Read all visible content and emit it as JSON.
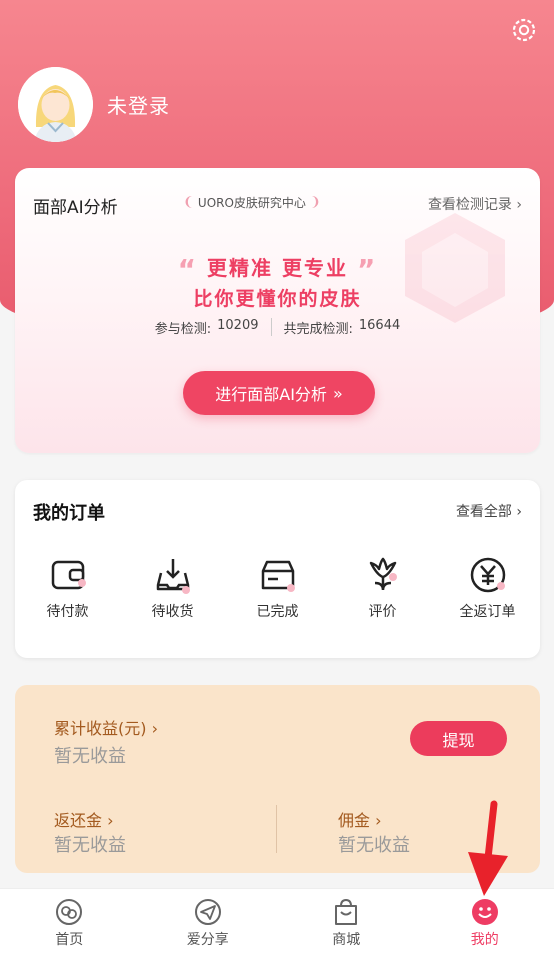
{
  "colors": {
    "accent": "#ef4563",
    "hero": "#ee6b7b",
    "earn_bg": "#fae4ca",
    "earn_text": "#a35a1f"
  },
  "header": {
    "user_name": "未登录",
    "settings_icon": "gear-icon"
  },
  "ai_card": {
    "title": "面部AI分析",
    "center_label": "UORO皮肤研究中心",
    "history_link": "查看检测记录",
    "slogan_line1": "更精准 更专业",
    "slogan_line2": "比你更懂你的皮肤",
    "participated_label": "参与检测:",
    "participated_value": "10209",
    "completed_label": "共完成检测:",
    "completed_value": "16644",
    "cta": "进行面部AI分析"
  },
  "orders": {
    "title": "我的订单",
    "view_all": "查看全部",
    "items": [
      {
        "label": "待付款",
        "icon": "wallet-icon"
      },
      {
        "label": "待收货",
        "icon": "inbox-download-icon"
      },
      {
        "label": "已完成",
        "icon": "box-icon"
      },
      {
        "label": "评价",
        "icon": "tulip-icon"
      },
      {
        "label": "全返订单",
        "icon": "yen-icon"
      }
    ]
  },
  "earnings": {
    "total_label": "累计收益(元)",
    "total_value": "暂无收益",
    "withdraw": "提现",
    "rebate_label": "返还金",
    "rebate_value": "暂无收益",
    "commission_label": "佣金",
    "commission_value": "暂无收益"
  },
  "tabbar": [
    {
      "label": "首页",
      "icon": "home-icon",
      "active": false
    },
    {
      "label": "爱分享",
      "icon": "share-icon",
      "active": false
    },
    {
      "label": "商城",
      "icon": "shopping-bag-icon",
      "active": false
    },
    {
      "label": "我的",
      "icon": "smile-icon",
      "active": true
    }
  ]
}
